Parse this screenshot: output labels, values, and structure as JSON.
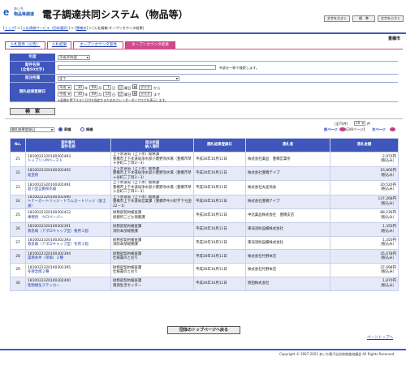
{
  "header": {
    "logo_top": "あいち",
    "logo_bottom": "物品等調達",
    "title": "電子調達共同システム（物品等）",
    "font_large": "文字を大きく",
    "font_std": "標　準",
    "font_small": "文字を小さく"
  },
  "breadcrumb": {
    "items": [
      "トップ",
      "入札情報サービス（団体選択）",
      "豊橋市"
    ],
    "current": "入札情報-オープンカウンタ結果"
  },
  "organization": "豊橋市",
  "tabs": [
    "入札案件（公告）",
    "入札結果",
    "オープンカウンタ案件",
    "オープンカウンタ結果"
  ],
  "form": {
    "fiscal_year_label": "年度",
    "fiscal_year_value": "平成30年度",
    "case_name_label": "案件名称\n(全角50文字)",
    "case_name_hint": "※部分一致で検索します。",
    "ordering_section_label": "発注所属",
    "ordering_section_value": "全て",
    "date_label": "開札結果登録日",
    "era": "平成",
    "from_year": "30",
    "from_month": "09",
    "from_day": "1",
    "from_dow": "日",
    "to_year": "30",
    "to_month": "09",
    "to_day": "14",
    "to_dow": "日",
    "unit_year": "年",
    "unit_month": "月",
    "unit_day": "日",
    "dow_suffix": "曜日",
    "clear": "クリア",
    "from_suffix": "から",
    "to_suffix": "まで",
    "date_hint": "※画像を押下すると日付を指定するためのカレンダーダイアログを表示します。",
    "search_button": "検　索"
  },
  "toolbar": {
    "sort_value": "開札結果登録日",
    "asc": "昇順",
    "desc": "降順",
    "count_prefix": "（全75件）",
    "per_page": "10",
    "per_page_suffix": "件",
    "page_display": "【3/8ページ】",
    "prev": "前ページ",
    "next": "次ページ"
  },
  "table": {
    "headers": [
      "No.",
      "案件番号\n案件名称",
      "発注所属\n納入場所",
      "開札結果登録日",
      "落札者",
      "落札金額"
    ],
    "rows": [
      {
        "no": "21",
        "code": "1810022320100302493",
        "name": "トップリンMベースト",
        "dept": "上下水道局（上下水）総務課",
        "place": "豊橋市上下水道局浄水部小鷹野浄水場（豊橋市草ヶ谷町二丁目3－3）",
        "date": "平成30年10月11日",
        "winner": "株式会社薬品　豊橋営業所",
        "amount": "2,970円",
        "tax": "（税込み）"
      },
      {
        "no": "22",
        "code": "1810022320100302492",
        "name": "殺虫剤",
        "dept": "上下水道局（上下水）総務課",
        "place": "豊橋市上下水道局浄水部小鷹野浄水場（豊橋市草ヶ谷町二丁目3－3）",
        "date": "平成30年10月11日",
        "winner": "株式会社豊橋テイプ",
        "amount": "16,800円",
        "tax": "（税込み）"
      },
      {
        "no": "23",
        "code": "1810022320100302491",
        "name": "超小型自動採水器",
        "dept": "上下水道局（上下水）総務課",
        "place": "豊橋市上下水道局浄水部小鷹野浄水場（豊橋市草ヶ谷町二丁目3－3）",
        "date": "平成30年10月11日",
        "winner": "株式会社丸産商会",
        "amount": "20,520円",
        "tax": "（税込み）"
      },
      {
        "no": "24",
        "code": "1810022320100302490",
        "name": "トナーカートリッジ・ドラムカートリッジ（富士通）",
        "dept": "上下水道局（上下水）総務課",
        "place": "豊橋市上下水道局営業課（豊橋市牛川町字下モ田22－1）",
        "date": "平成30年10月11日",
        "winner": "株式会社豊橋テイプ",
        "amount": "137,268円",
        "tax": "（税込み）"
      },
      {
        "no": "25",
        "code": "1810022320100302412",
        "name": "事務用　ウロペーパー",
        "dept": "財務部契約検査課",
        "place": "保健所こども保健課",
        "date": "平成30年10月11日",
        "winner": "中北薬品株式会社　豊橋支店",
        "amount": "88,236円",
        "tax": "（税込み）"
      },
      {
        "no": "26",
        "code": "1810022320100302391",
        "name": "救急端（アポロキャップ型）要用１個",
        "dept": "財務部契約検査課",
        "place": "消防本部総務課",
        "date": "平成30年10月11日",
        "winner": "東海消防設備株式会社",
        "amount": "1,350円",
        "tax": "（税込み）"
      },
      {
        "no": "27",
        "code": "1810022320100302393",
        "name": "救急端（アポロキャップ型）冬用１個",
        "dept": "財務部契約検査課",
        "place": "消防本部総務課",
        "date": "平成30年10月11日",
        "winner": "東海消防設備株式会社",
        "amount": "1,350円",
        "tax": "（税込み）"
      },
      {
        "no": "28",
        "code": "1810022320100302394",
        "name": "業務条件（単価）２種",
        "dept": "財務部契約検査課",
        "place": "仕様書のとおり",
        "date": "平成30年10月11日",
        "winner": "株式会社竹野本店",
        "amount": "35,078円",
        "tax": "（税込み）"
      },
      {
        "no": "29",
        "code": "1810022320100302395",
        "name": "冬救急端２種",
        "dept": "財務部契約検査課",
        "place": "仕様書のとおり",
        "date": "平成30年10月11日",
        "winner": "株式会社竹野本店",
        "amount": "37,098円",
        "tax": "（税込み）"
      },
      {
        "no": "30",
        "code": "1810022320100302400",
        "name": "乾物端生ステッカー",
        "dept": "財務部契約検査課",
        "place": "資源生活センター",
        "date": "平成30年10月11日",
        "winner": "原田株式会社",
        "amount": "1,870円",
        "tax": "（税込み）"
      }
    ]
  },
  "back_button": "団体のトップページへ戻る",
  "page_top": "ページトップへ",
  "footer": {
    "copyright": "Copyright © 2007-2021 あいち電子自治体推進協議会 All Rights Reserved"
  },
  "colors": {
    "header_blue": "#3f56bd",
    "tab_pink": "#d24a8a",
    "row_alt": "#e6e9f7"
  }
}
